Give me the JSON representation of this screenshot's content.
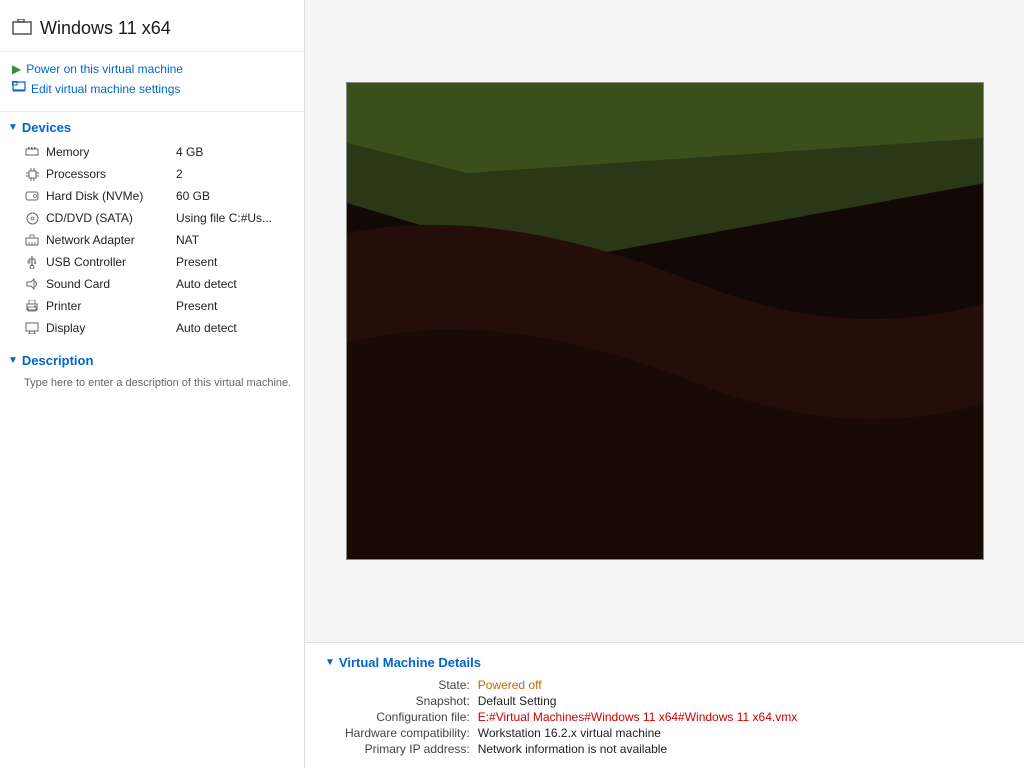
{
  "window": {
    "title": "Windows 11 x64"
  },
  "actions": {
    "power_on": "Power on this virtual machine",
    "edit_settings": "Edit virtual machine settings"
  },
  "devices_section": {
    "label": "Devices",
    "items": [
      {
        "icon": "memory-icon",
        "name": "Memory",
        "value": "4 GB"
      },
      {
        "icon": "cpu-icon",
        "name": "Processors",
        "value": "2"
      },
      {
        "icon": "hdd-icon",
        "name": "Hard Disk (NVMe)",
        "value": "60 GB"
      },
      {
        "icon": "dvd-icon",
        "name": "CD/DVD (SATA)",
        "value": "Using file C:#Us..."
      },
      {
        "icon": "network-icon",
        "name": "Network Adapter",
        "value": "NAT"
      },
      {
        "icon": "usb-icon",
        "name": "USB Controller",
        "value": "Present"
      },
      {
        "icon": "sound-icon",
        "name": "Sound Card",
        "value": "Auto detect"
      },
      {
        "icon": "printer-icon",
        "name": "Printer",
        "value": "Present"
      },
      {
        "icon": "display-icon",
        "name": "Display",
        "value": "Auto detect"
      }
    ]
  },
  "description_section": {
    "label": "Description",
    "placeholder": "Type here to enter a description of this virtual machine."
  },
  "vm_details": {
    "label": "Virtual Machine Details",
    "state_label": "State:",
    "state_value": "Powered off",
    "snapshot_label": "Snapshot:",
    "snapshot_value": "Default Setting",
    "config_label": "Configuration file:",
    "config_value": "E:#Virtual Machines#Windows 11 x64#Windows 11 x64.vmx",
    "hardware_label": "Hardware compatibility:",
    "hardware_value": "Workstation 16.2.x virtual machine",
    "ip_label": "Primary IP address:",
    "ip_value": "Network information is not available"
  }
}
